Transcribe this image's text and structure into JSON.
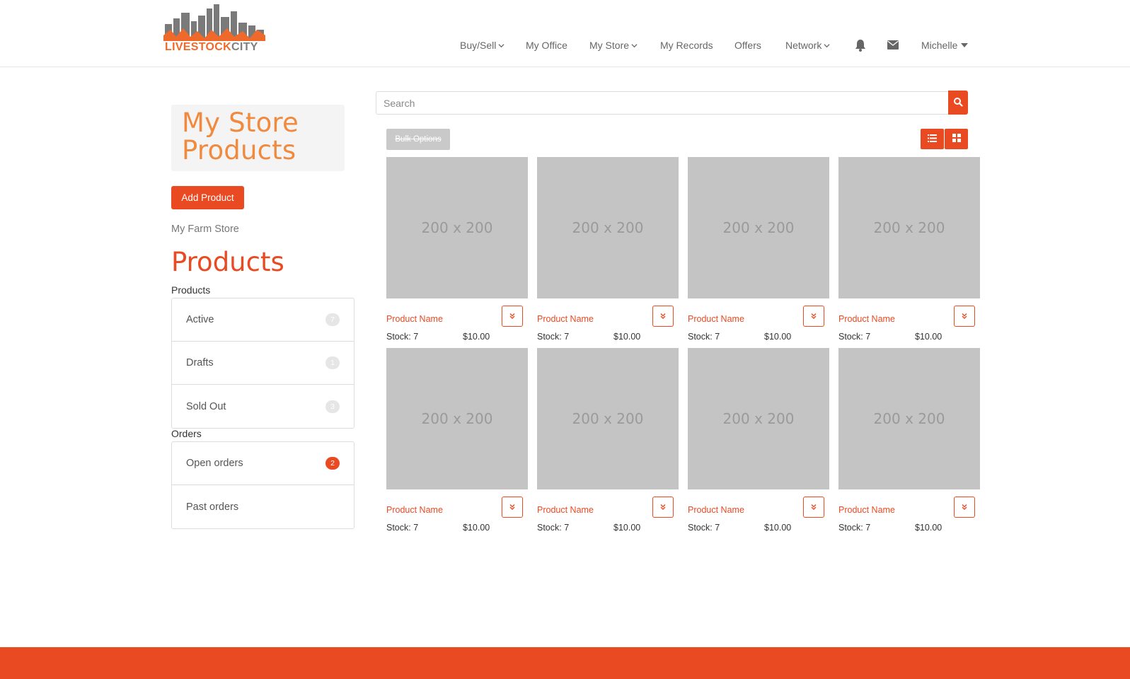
{
  "brand": {
    "logo_part1": "LIVESTOCK",
    "logo_part2": "CITY",
    "accent": "#ea4a22",
    "logo_orange": "#ef6a2a"
  },
  "nav": {
    "buy_sell": "Buy/Sell",
    "my_office": "My Office",
    "my_store": "My Store",
    "my_records": "My Records",
    "offers": "Offers",
    "network": "Network",
    "user": "Michelle",
    "icons": [
      "bell-icon",
      "envelope-icon"
    ]
  },
  "sidebar": {
    "title_line1": "My Store",
    "title_line2": "Products",
    "add_product": "Add Product",
    "store_name": "My Farm Store",
    "products_heading": "Products",
    "products_label": "Products",
    "product_items": [
      {
        "label": "Active",
        "count": "7"
      },
      {
        "label": "Drafts",
        "count": "1"
      },
      {
        "label": "Sold Out",
        "count": "3"
      }
    ],
    "orders_label": "Orders",
    "order_items": [
      {
        "label": "Open orders",
        "count": "2"
      },
      {
        "label": "Past orders",
        "count": ""
      }
    ]
  },
  "search": {
    "placeholder": "Search"
  },
  "toolbar": {
    "bulk_options": "Bulk Options",
    "view_icons": [
      "list-view-icon",
      "grid-view-icon"
    ]
  },
  "products": [
    {
      "image_text": "200 x 200",
      "name": "Product Name",
      "stock": "Stock: 7",
      "price": "$10.00"
    },
    {
      "image_text": "200 x 200",
      "name": "Product Name",
      "stock": "Stock: 7",
      "price": "$10.00"
    },
    {
      "image_text": "200 x 200",
      "name": "Product Name",
      "stock": "Stock: 7",
      "price": "$10.00"
    },
    {
      "image_text": "200 x 200",
      "name": "Product Name",
      "stock": "Stock: 7",
      "price": "$10.00"
    },
    {
      "image_text": "200 x 200",
      "name": "Product Name",
      "stock": "Stock: 7",
      "price": "$10.00"
    },
    {
      "image_text": "200 x 200",
      "name": "Product Name",
      "stock": "Stock: 7",
      "price": "$10.00"
    },
    {
      "image_text": "200 x 200",
      "name": "Product Name",
      "stock": "Stock: 7",
      "price": "$10.00"
    },
    {
      "image_text": "200 x 200",
      "name": "Product Name",
      "stock": "Stock: 7",
      "price": "$10.00"
    }
  ]
}
